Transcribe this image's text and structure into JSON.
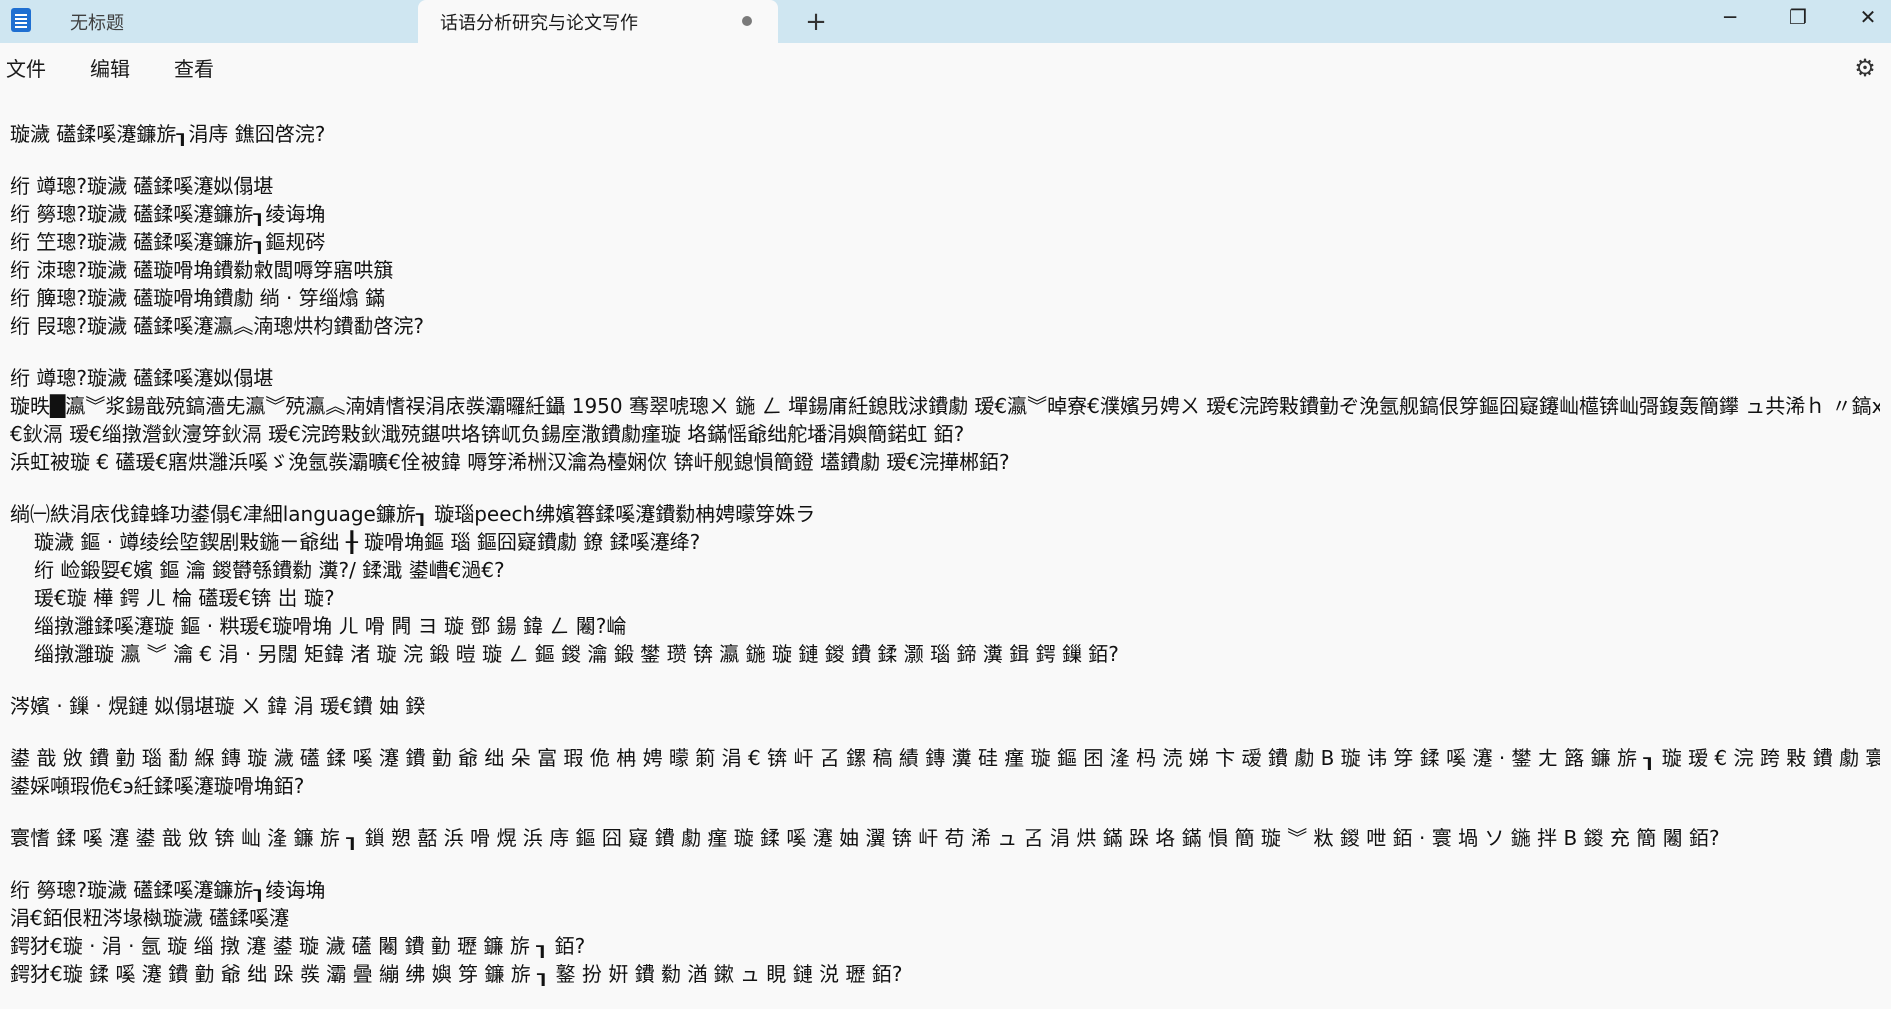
{
  "window": {
    "tabs": [
      {
        "label": "无标题",
        "active": false
      },
      {
        "label": "话语分析研究与论文写作",
        "active": true,
        "unsaved": true
      }
    ],
    "new_tab_symbol": "+",
    "controls": {
      "minimize": "─",
      "maximize": "❐",
      "close": "✕"
    }
  },
  "menu": {
    "file": "文件",
    "edit": "编辑",
    "view": "查看",
    "settings_icon": "⚙"
  },
  "document": {
    "lines": [
      {
        "text": "璇濊 礚鍒嗘瀽鐮旂┒涓庤 鐎囧啓浣?",
        "type": "normal"
      },
      {
        "type": "blank"
      },
      {
        "text": "绗 竴璁?璇濊 礚鍒嗘瀽姒傝堪",
        "type": "normal"
      },
      {
        "text": "绗 簩璁?璇濊 礚鍒嗘瀽鐮旂┒绫诲埆",
        "type": "normal"
      },
      {
        "text": "绗 笁璁?璇濊 礚鍒嗘瀽鐮旂┒鏂规硶",
        "type": "normal"
      },
      {
        "text": "绗 洓璁?璇濊 礚璇嗗埆鐨勬敹闆嗕笌寤哄簱",
        "type": "normal"
      },
      {
        "text": "绗 簲璁?璇濊 礚璇嗗埆鐨勮 绱 · 笌缁熻 鏋",
        "type": "normal"
      },
      {
        "text": "绗 叚璁?璇濊 礚鍒嗘瀽瀛︽湳璁烘枃鐨勫啓浣?",
        "type": "normal"
      },
      {
        "type": "blank"
      },
      {
        "text": "绗 竴璁?璇濊 礚鍒嗘瀽姒傝堪",
        "type": "normal"
      },
      {
        "text": "璇昳█瀛︾浆鍚戠殑鎬濇兂瀛︾殑瀛︽湳婧愭祦涓庡彂灞曪紝鑷 1950 骞翠唬璁ㄨ 鍦 ㄥ 墠鍚庯紝鎴戝浗鐨勮 瑷€瀛︾晫寮€濮嬪叧娉ㄨ 瑷€浣跨敤鐨勭ぞ浼氬舰鎬佷笌鏂囧寲鑳屾櫙锛屾彁鍑轰簡鑻 ュ共浠ｈ 〃鎬х殑瑙傜偣銆?",
        "type": "normal"
      },
      {
        "text": "€鈥滆 瑷€缁撴瀯鈥濅笌鈥滆 瑷€浣跨敤鈥濈殑鍖哄垎锛屼负鍚庢潵鐨勮瘽璇 垎鏋愮爺绌舵墦涓嬩簡鍩虹 銆?",
        "type": "normal"
      },
      {
        "text": "浜虹被璇 € 礚瑗€寤烘灉浜嗘ゞ浼氬彂灞曠€佺被鍏 嗕笌浠栦汉瀹為檯娴佽 锛屽舰鎴愪簡鐙 壒鐨勮 瑷€浣撶郴銆?",
        "type": "normal"
      },
      {
        "type": "blank"
      },
      {
        "text": "绱㈠紩涓庡伐鍏蜂功鍙傝€冿細language鐮旂┒ 璇瑙peech绋嬪簭鍒嗘瀽鐨勬柟娉曚笌姝ラ",
        "type": "normal"
      },
      {
        "text": "璇濊 鏂 · 竴绫绘埅鍥剧敤鍦ㄧ爺绌 ╂ 璇嗗埆鏂 瑙 鏂囧寲鐨勮 鐐 鍒嗘瀽绛?",
        "type": "indent"
      },
      {
        "text": "绗 崄鍛娿€嬪 鏂 瀹 鍐欎綔鐨勬 瀵?/ 鍒濈 鍙嶆€濄€?",
        "type": "indent"
      },
      {
        "text": "瑗€璇 樺 鍔 ㄦ 棆 礚瑗€锛 岀 璇?",
        "type": "indent"
      },
      {
        "text": "缁撴灉鍒嗘瀽璇 鏂 · 粠瑗€璇嗗埆 ㄦ 嗗 闁 ヨ 璇 鄧 鍚 鍏 ㄥ 闂?崘",
        "type": "indent"
      },
      {
        "text": "缁撴灉璇 瀛 ︾ 瀹 € 涓 · 另闊 矩鍏 渚 璇 浣 鍛 暟 璇 ㄥ 鏂 鍐 瀹 鍛 鐢 瓒 锛 瀛 鍦 璇 鏈 鍐 鐨 鍒 灏 瑙 鍗 瀵 鍓 鍔 鏁 銆?",
        "type": "indent"
      },
      {
        "type": "blank"
      },
      {
        "text": "涔嬪 · 鏁 · 熀鏈 姒傝堪璇 ㄨ 鍏 涓 瑗€鐨 妯 鍨",
        "type": "normal"
      },
      {
        "type": "blank"
      },
      {
        "text": "鍙 戠 敓 鐨 勭 瑙 勫 緥 鏄 璇 濊 礚 鍒 嗘 瀽 鐨 勭 爺 绌 朵 富 瑕 佹 柟 娉 曚 箣 涓 € 锛 屽 叾 鏍 稿 績 鏄 瀵 硅 瘽 璇 鏂 囨 湰 杩 涜 娣 卞 叆 鐨 勮 В 璇 讳 笌 鍒 嗘 瀽 · 鐢 ㄤ 簬 鐮 旂 ┒ 璇 瑷 € 浣 跨 敤 鐨 勮 寰 嬬 瓑 銆 · 鐩 存 帴 浣 跨 敤",
        "type": "normal"
      },
      {
        "text": "鍙婇噸瑕佹€э紝鍒嗘瀽璇嗗埆銆?",
        "type": "normal"
      },
      {
        "type": "blank"
      },
      {
        "text": "寰愭 鍒 嗘 瀽 鍙 戠 敓 锛 屾 湰 鐮 旂 ┒ 鎻 愬 嚭 浜 嗗 熀 浜 庤 鏂 囧 寲 鐨 勮 瘽 璇 鍒 嗘 瀽 妯 瀷 锛 屽 苟 浠 ュ 叾 涓 烘 鏋 跺 垎 鏋 愪 簡 璇 ︾ 粏 鍐 呭 銆 · 寰 堝 ソ 鍦 拌 В 鍐 充 簡 闂 銆?",
        "type": "normal"
      },
      {
        "type": "blank"
      },
      {
        "text": "绗 簩璁?璇濊 礚鍒嗘瀽鐮旂┒绫诲埆",
        "type": "normal"
      },
      {
        "text": "涓€銆佷粈涔堟槸璇濊 礚鍒嗘瀽",
        "type": "normal"
      },
      {
        "text": "鍔犲€璇 · 涓 · 氬 璇 缁 撴 瀽 鍙 璇 濊 礚 闂 鐨 勭 瓑 鐮 旂 ┒ 銆?",
        "type": "normal"
      },
      {
        "text": "鍔犲€璇 鍒 嗘 瀽 鐨 勭 爺 绌 跺 彂 灞 曡 繃 绋 嬩 笌 鐮 旂 ┒ 鐜 扮 姸 鐨 勬 湭 鏉 ュ 睍 鏈 涚 瓑 銆?",
        "type": "normal"
      }
    ]
  }
}
